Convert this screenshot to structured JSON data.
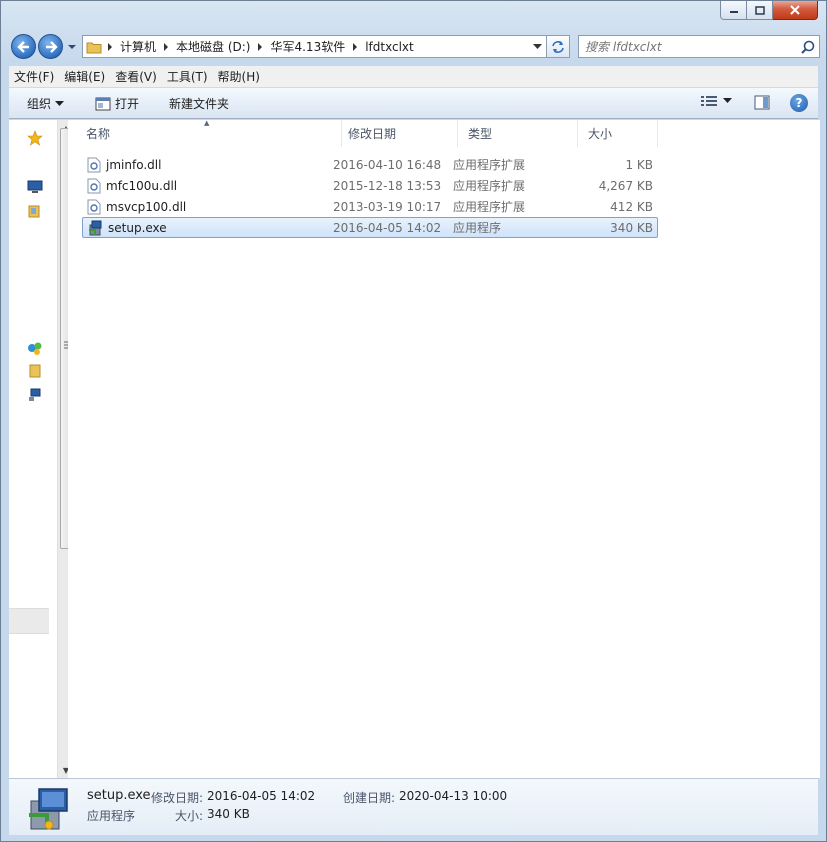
{
  "window": {
    "min": "minimize",
    "max": "maximize",
    "close": "close"
  },
  "address": {
    "crumbs": [
      "计算机",
      "本地磁盘 (D:)",
      "华军4.13软件",
      "lfdtxclxt"
    ]
  },
  "search": {
    "placeholder": "搜索 lfdtxclxt"
  },
  "menu": [
    "文件(F)",
    "编辑(E)",
    "查看(V)",
    "工具(T)",
    "帮助(H)"
  ],
  "toolbar": {
    "organize": "组织",
    "open": "打开",
    "new_folder": "新建文件夹"
  },
  "columns": {
    "name": "名称",
    "date": "修改日期",
    "type": "类型",
    "size": "大小"
  },
  "files": [
    {
      "name": "jminfo.dll",
      "date": "2016-04-10 16:48",
      "type": "应用程序扩展",
      "size": "1 KB",
      "icon": "dll-file-icon"
    },
    {
      "name": "mfc100u.dll",
      "date": "2015-12-18 13:53",
      "type": "应用程序扩展",
      "size": "4,267 KB",
      "icon": "dll-file-icon"
    },
    {
      "name": "msvcp100.dll",
      "date": "2013-03-19 10:17",
      "type": "应用程序扩展",
      "size": "412 KB",
      "icon": "dll-file-icon"
    },
    {
      "name": "setup.exe",
      "date": "2016-04-05 14:02",
      "type": "应用程序",
      "size": "340 KB",
      "icon": "installer-icon",
      "selected": true
    }
  ],
  "details": {
    "name": "setup.exe",
    "modified_label": "修改日期:",
    "modified": "2016-04-05 14:02",
    "created_label": "创建日期:",
    "created": "2020-04-13 10:00",
    "type": "应用程序",
    "size_label": "大小:",
    "size": "340 KB"
  },
  "colors": {
    "selection": "#cfe3fa",
    "selection_border": "#7da2ce",
    "chrome": "#c5d8ec"
  }
}
